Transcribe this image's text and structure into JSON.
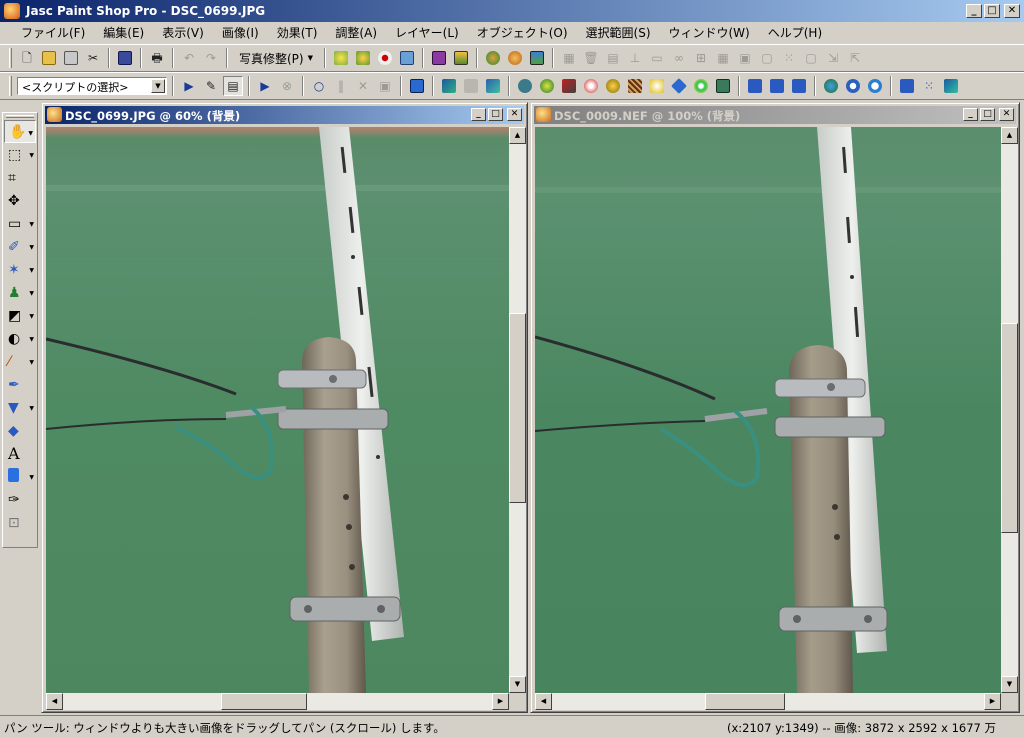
{
  "window": {
    "title": "Jasc Paint Shop Pro - DSC_0699.JPG",
    "minimize": "_",
    "maximize": "□",
    "close": "✕"
  },
  "menu": [
    "ファイル(F)",
    "編集(E)",
    "表示(V)",
    "画像(I)",
    "効果(T)",
    "調整(A)",
    "レイヤー(L)",
    "オブジェクト(O)",
    "選択範囲(S)",
    "ウィンドウ(W)",
    "ヘルプ(H)"
  ],
  "toolbar": {
    "photo_fix_label": "写真修整(P)",
    "script_select_value": "<スクリプトの選択>"
  },
  "documents": [
    {
      "title": "DSC_0699.JPG @  60% (背景)",
      "active": true
    },
    {
      "title": "DSC_0009.NEF @ 100% (背景)",
      "active": false
    }
  ],
  "status": {
    "tool_hint": "パン ツール: ウィンドウよりも大きい画像をドラッグしてパン (スクロール) します。",
    "info": "(x:2107 y:1349) -- 画像:  3872 x 2592 x 1677 万"
  },
  "colors": {
    "title_active_start": "#0a246a",
    "title_active_end": "#a6caf0",
    "face": "#d4d0c8",
    "wall_green": "#4e8a63"
  }
}
